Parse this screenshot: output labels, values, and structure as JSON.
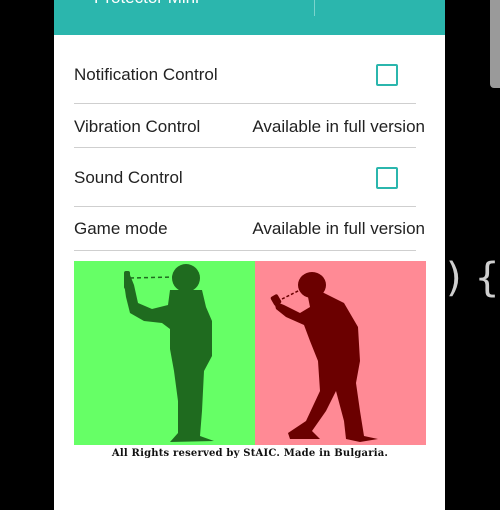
{
  "app": {
    "title": "Protector Mini"
  },
  "settings": [
    {
      "label": "Notification Control",
      "control": "checkbox",
      "checked": false
    },
    {
      "label": "Vibration Control",
      "control": "text",
      "value": "Available in full version"
    },
    {
      "label": "Sound Control",
      "control": "checkbox",
      "checked": false
    },
    {
      "label": "Game mode",
      "control": "text",
      "value": "Available in full version"
    }
  ],
  "illustration": {
    "good_posture_color": "#66ff66",
    "bad_posture_color": "#ff8a95",
    "silhouette_good_color": "#1f6b1f",
    "silhouette_bad_color": "#6b0000"
  },
  "footer": {
    "caption": "All Rights reserved by StAIC. Made in Bulgaria."
  },
  "background": {
    "partial_text": ") {"
  },
  "colors": {
    "accent": "#2bb6ad"
  }
}
